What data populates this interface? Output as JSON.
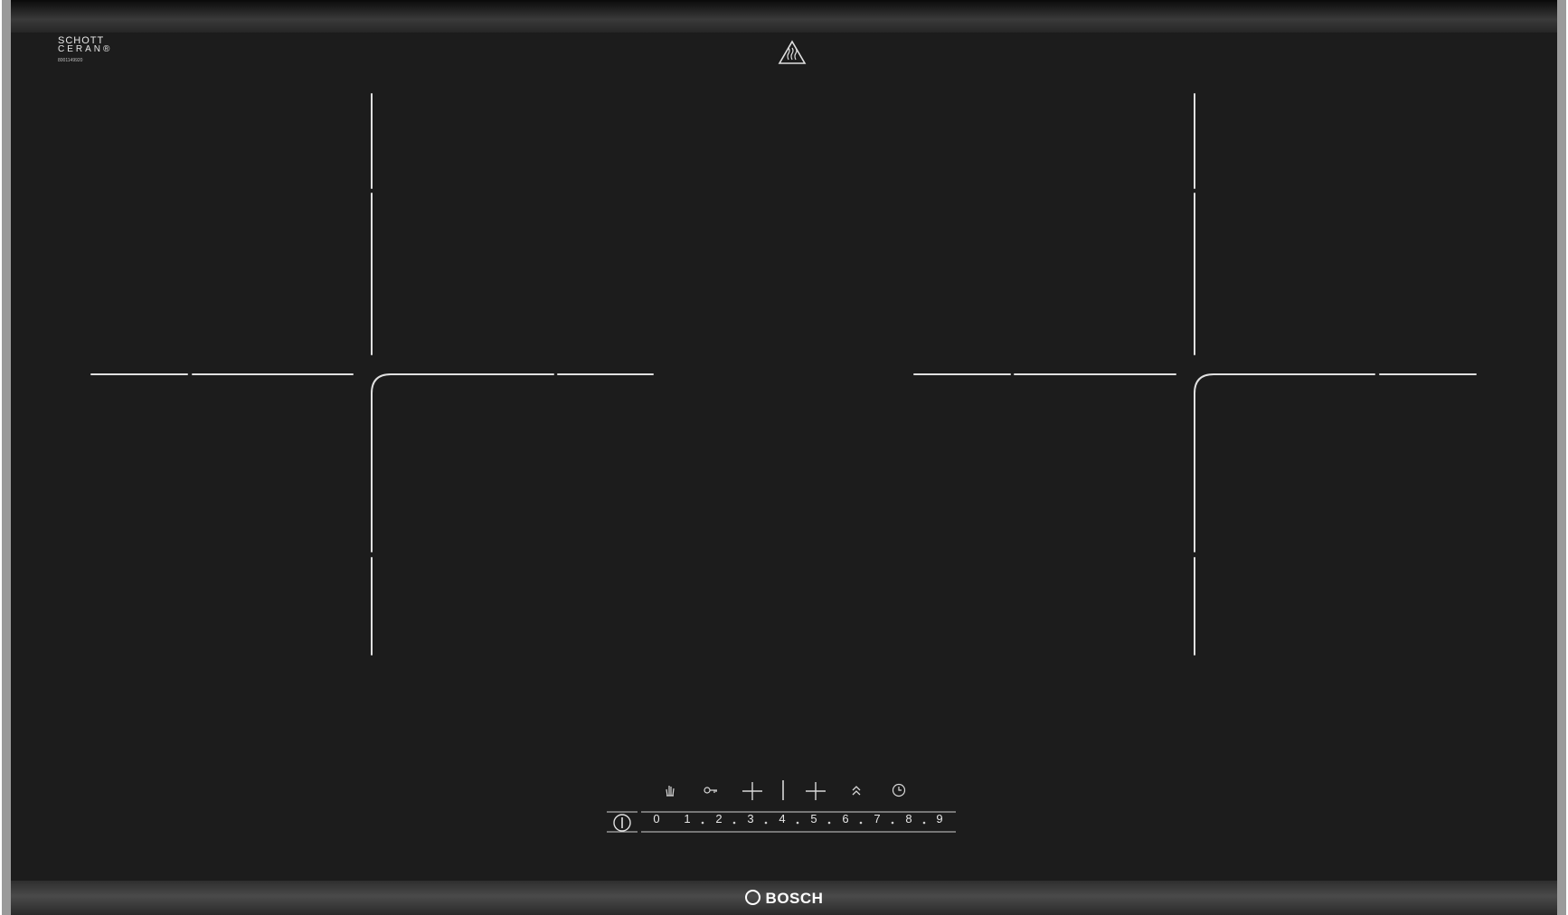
{
  "hob": {
    "certification": {
      "brand_line1": "SCHOTT",
      "brand_line2": "CERAN®",
      "code": "8001149920"
    },
    "warning": "hot-surface-warning-icon",
    "controls": {
      "icons": [
        "wipe-protect-icon",
        "key-lock-icon",
        "zone-select-left-icon",
        "zone-select-right-icon",
        "powerboost-icon",
        "timer-icon"
      ],
      "power_slider": {
        "labels": [
          "0",
          "1",
          "2",
          "3",
          "4",
          "5",
          "6",
          "7",
          "8",
          "9"
        ]
      },
      "power_button": "power-icon"
    },
    "brand": "BOSCH",
    "colors": {
      "glass": "#1c1c1c",
      "frame": "#9a9a9a",
      "markings": "#e0e0e0"
    }
  }
}
